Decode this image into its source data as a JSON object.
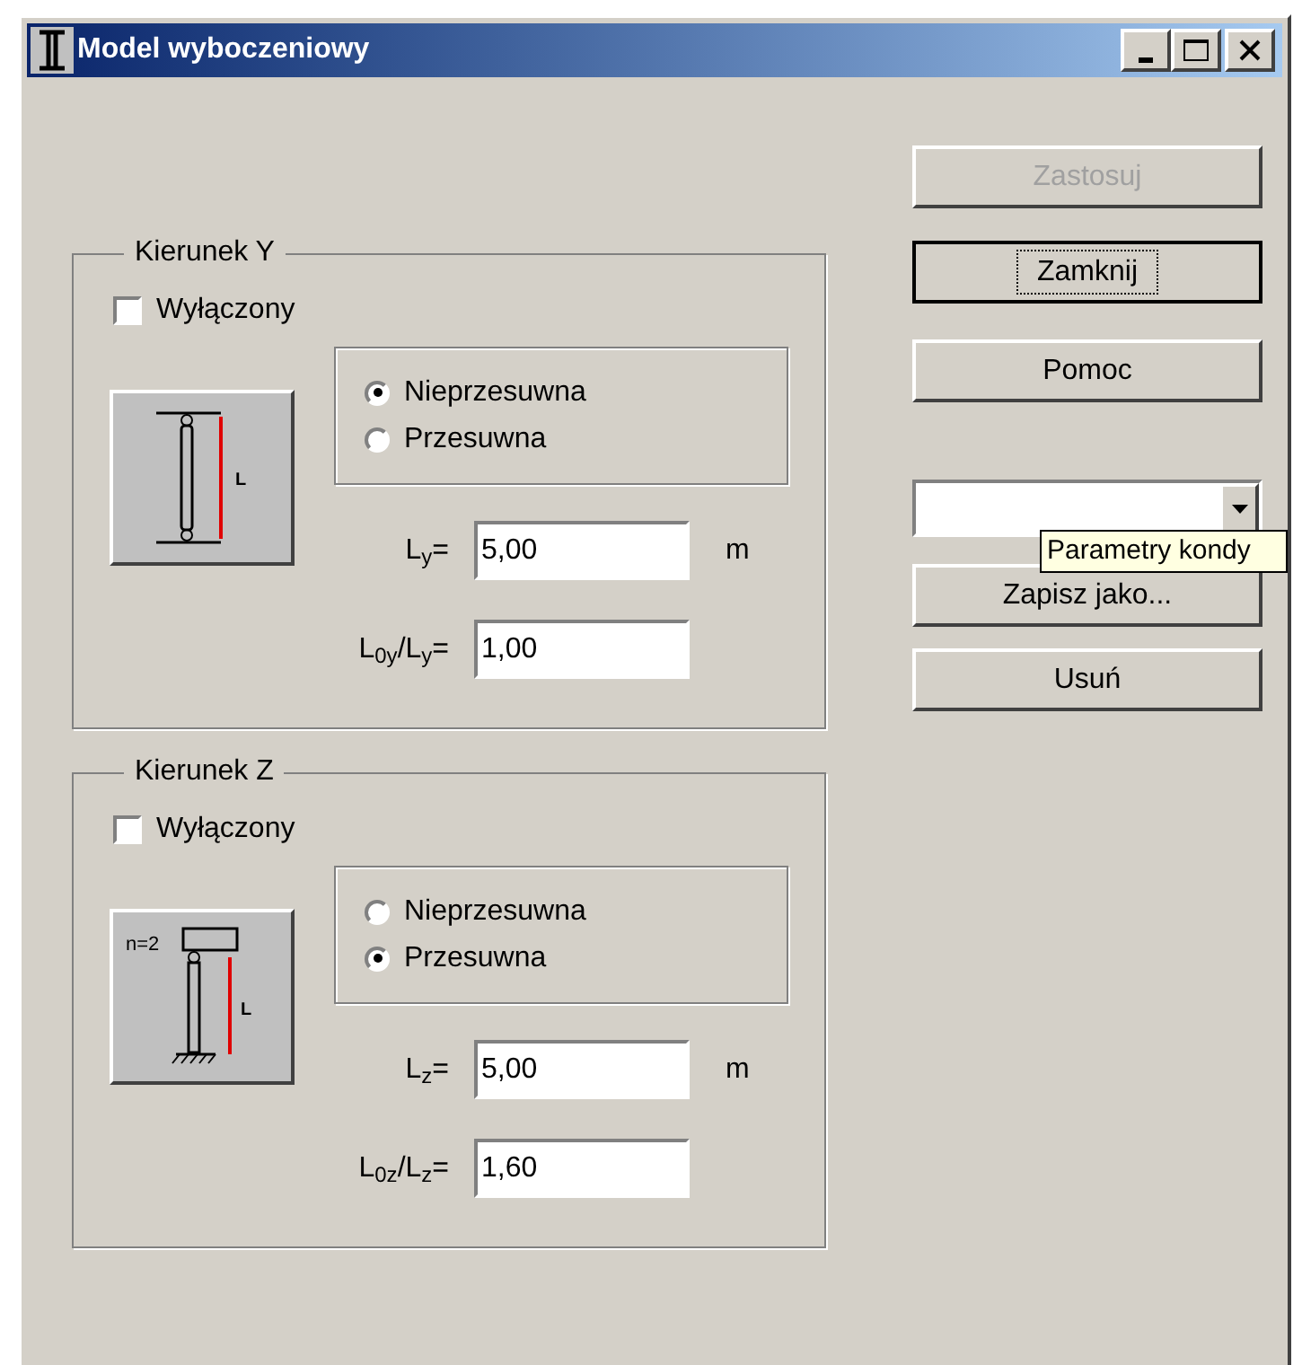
{
  "window": {
    "title": "Model wyboczeniowy"
  },
  "groups": [
    {
      "title": "Kierunek Y",
      "off_checkbox": {
        "label": "Wyłączony",
        "checked": false
      },
      "diagram": {
        "kind": "pinned",
        "dimension": "L"
      },
      "options": [
        {
          "label": "Nieprzesuwna",
          "selected": true
        },
        {
          "label": "Przesuwna",
          "selected": false
        }
      ],
      "length": {
        "label": "L$_{y}$=",
        "value": "5,00",
        "unit": "m"
      },
      "ratio": {
        "label": "L$_{0y}$/L$_{y}$=",
        "value": "1,00"
      }
    },
    {
      "title": "Kierunek Z",
      "off_checkbox": {
        "label": "Wyłączony",
        "checked": false
      },
      "diagram": {
        "kind": "sway",
        "dimension": "L",
        "note": "n=2"
      },
      "options": [
        {
          "label": "Nieprzesuwna",
          "selected": false
        },
        {
          "label": "Przesuwna",
          "selected": true
        }
      ],
      "length": {
        "label": "L$_{z}$=",
        "value": "5,00",
        "unit": "m"
      },
      "ratio": {
        "label": "L$_{0z}$/L$_{z}$=",
        "value": "1,60"
      }
    }
  ],
  "buttons": [
    {
      "label": "Zastosuj",
      "disabled": true,
      "focused": false
    },
    {
      "label": "Zamknij",
      "disabled": false,
      "focused": true
    },
    {
      "label": "Pomoc",
      "disabled": false,
      "focused": false
    }
  ],
  "lower_buttons": [
    {
      "label": "Zapisz jako...",
      "disabled": false
    },
    {
      "label": "Usuń",
      "disabled": false
    }
  ],
  "tooltip": {
    "text": "Parametry kondy"
  }
}
